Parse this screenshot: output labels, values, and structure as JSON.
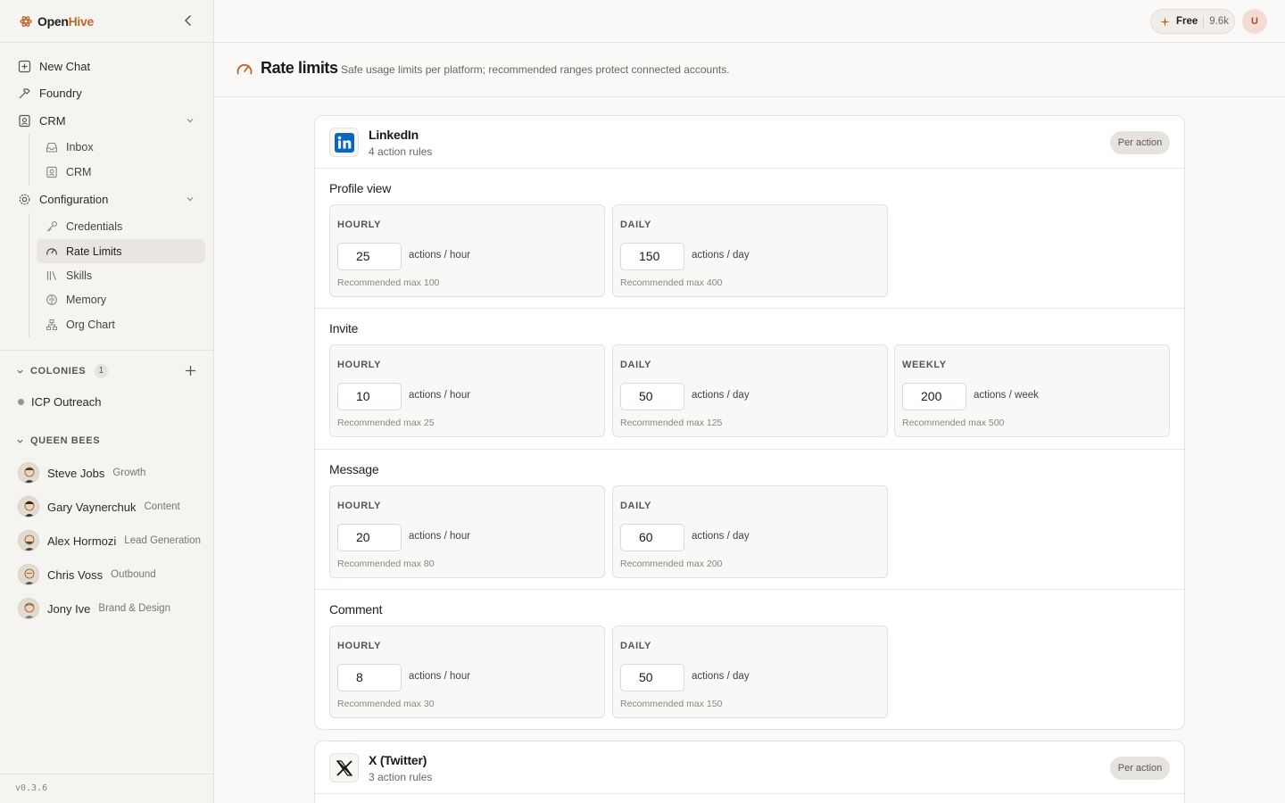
{
  "sidebar": {
    "brand": {
      "part1": "Open",
      "part2": "Hive"
    },
    "nav": [
      {
        "label": "New Chat",
        "icon": "new-chat-icon"
      },
      {
        "label": "Foundry",
        "icon": "hammer-icon"
      },
      {
        "label": "CRM",
        "icon": "contact-card-icon"
      }
    ],
    "crm_children": [
      {
        "label": "Inbox",
        "icon": "inbox-icon"
      },
      {
        "label": "CRM",
        "icon": "contact-card-icon"
      }
    ],
    "configuration": {
      "label": "Configuration",
      "icon": "gear-icon"
    },
    "config_children": [
      {
        "label": "Credentials",
        "icon": "key-icon"
      },
      {
        "label": "Rate Limits",
        "icon": "gauge-icon",
        "active": true
      },
      {
        "label": "Skills",
        "icon": "library-icon"
      },
      {
        "label": "Memory",
        "icon": "brain-icon"
      },
      {
        "label": "Org Chart",
        "icon": "org-chart-icon"
      }
    ],
    "colonies": {
      "title": "COLONIES",
      "count": "1",
      "items": [
        "ICP Outreach"
      ]
    },
    "queen_bees": {
      "title": "QUEEN BEES",
      "items": [
        {
          "name": "Steve Jobs",
          "role": "Growth"
        },
        {
          "name": "Gary Vaynerchuk",
          "role": "Content"
        },
        {
          "name": "Alex Hormozi",
          "role": "Lead Generation"
        },
        {
          "name": "Chris Voss",
          "role": "Outbound"
        },
        {
          "name": "Jony Ive",
          "role": "Brand & Design"
        }
      ]
    },
    "version": "v0.3.6"
  },
  "topbar": {
    "plan": "Free",
    "credits": "9.6k",
    "user_initial": "U"
  },
  "page": {
    "title": "Rate limits",
    "subtitle": "Safe usage limits per platform; recommended ranges protect connected accounts."
  },
  "platforms": [
    {
      "name": "LinkedIn",
      "rules_count": "4 action rules",
      "mode": "Per action",
      "logo": "linkedin-logo",
      "actions": [
        {
          "title": "Profile view",
          "limits": [
            {
              "period": "HOURLY",
              "value": "25",
              "unit": "actions / hour",
              "recommended": "Recommended max 100"
            },
            {
              "period": "DAILY",
              "value": "150",
              "unit": "actions / day",
              "recommended": "Recommended max 400"
            }
          ]
        },
        {
          "title": "Invite",
          "limits": [
            {
              "period": "HOURLY",
              "value": "10",
              "unit": "actions / hour",
              "recommended": "Recommended max 25"
            },
            {
              "period": "DAILY",
              "value": "50",
              "unit": "actions / day",
              "recommended": "Recommended max 125"
            },
            {
              "period": "WEEKLY",
              "value": "200",
              "unit": "actions / week",
              "recommended": "Recommended max 500"
            }
          ]
        },
        {
          "title": "Message",
          "limits": [
            {
              "period": "HOURLY",
              "value": "20",
              "unit": "actions / hour",
              "recommended": "Recommended max 80"
            },
            {
              "period": "DAILY",
              "value": "60",
              "unit": "actions / day",
              "recommended": "Recommended max 200"
            }
          ]
        },
        {
          "title": "Comment",
          "limits": [
            {
              "period": "HOURLY",
              "value": "8",
              "unit": "actions / hour",
              "recommended": "Recommended max 30"
            },
            {
              "period": "DAILY",
              "value": "50",
              "unit": "actions / day",
              "recommended": "Recommended max 150"
            }
          ]
        }
      ]
    },
    {
      "name": "X (Twitter)",
      "rules_count": "3 action rules",
      "mode": "Per action",
      "logo": "x-logo",
      "actions": []
    }
  ],
  "colors": {
    "accent": "#c0662b",
    "linkedin": "#0a66c2"
  }
}
